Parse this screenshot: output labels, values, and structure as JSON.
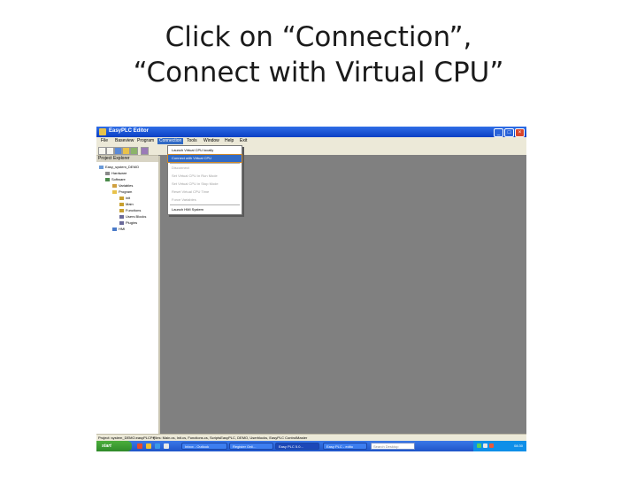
{
  "slide": {
    "title_line1": "Click on “Connection”,",
    "title_line2": "“Connect with Virtual CPU”"
  },
  "window": {
    "title": "EasyPLC Editor",
    "buttons": {
      "minimize": "_",
      "maximize": "□",
      "close": "×"
    }
  },
  "menubar": {
    "items": [
      "File",
      "Baseview",
      "Program",
      "Connection",
      "Tools",
      "Window",
      "Help",
      "Exit"
    ],
    "active": "Connection"
  },
  "explorer": {
    "header": "Project Explorer",
    "items": [
      "Easy_system_DEMO",
      "Hardware",
      "Software",
      "Variables",
      "Program",
      "init",
      "Main",
      "Functions",
      "Users Blocks",
      "Plugins",
      "HMI"
    ]
  },
  "connection_menu": {
    "items": [
      {
        "label": "Launch Virtual CPU locally",
        "state": "normal"
      },
      {
        "label": "Connect with Virtual CPU",
        "state": "highlighted"
      },
      {
        "label": "Disconnect",
        "state": "disabled"
      },
      {
        "label": "Set Virtual CPU in Run Mode",
        "state": "disabled"
      },
      {
        "label": "Set Virtual CPU in Stop Mode",
        "state": "disabled"
      },
      {
        "label": "Reset Virtual CPU Time",
        "state": "disabled"
      },
      {
        "label": "Force Variables",
        "state": "disabled"
      },
      {
        "label": "Launch HMI System",
        "state": "normal"
      }
    ]
  },
  "statusbar": {
    "left": "Project: system_DEMO.easyPLCPrj",
    "right": "Files: Main.cs, Init.cs, Functions.cs, ScriptsEasyPLC, DEMO, Userblocks, EasyPLC ControlMaster"
  },
  "taskbar": {
    "start_label": "start",
    "tasks": [
      "Inbox - Outlook",
      "Register Onli...",
      "Easy PLC 5.0...",
      "Easy PLC - edito"
    ],
    "active_task": "Easy PLC 5.0...",
    "search_placeholder": "Search Desktop",
    "clock": "08:30"
  },
  "colors": {
    "titlebar": "#0a3fc4",
    "menu_highlight": "#316ac5",
    "workspace": "#808080",
    "taskbar": "#245edb",
    "start_button": "#3c9a34"
  }
}
